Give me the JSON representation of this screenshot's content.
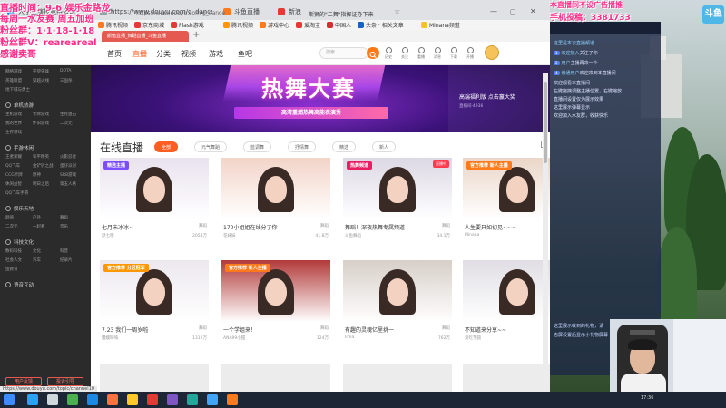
{
  "browser": {
    "tabs": [
      {
        "label": "大学生演技竞赛公司",
        "color": "#1e88e5"
      },
      {
        "label": "https://www.douyu.com/g_dance",
        "color": "#9aa0a6"
      },
      {
        "label": "斗鱼直播",
        "color": "#ff7a1a"
      },
      {
        "label": "新浪",
        "color": "#e53935"
      }
    ],
    "address_url": "https://www.douyu.com/g_dance",
    "address_news": "斯狮的\"二舞\"指挥证办下来",
    "bookmarks": [
      {
        "label": "腾讯视频",
        "color": "#ff7a1a"
      },
      {
        "label": "京东商城",
        "color": "#e53935"
      },
      {
        "label": "Flash游戏",
        "color": "#e53935"
      },
      {
        "label": "腾讯视频",
        "color": "#ff9800"
      },
      {
        "label": "游戏中心",
        "color": "#ff7a1a"
      },
      {
        "label": "爱淘宝",
        "color": "#e53935"
      },
      {
        "label": "中国人",
        "color": "#d32f2f"
      },
      {
        "label": "头条 · 相关文章",
        "color": "#1565c0"
      },
      {
        "label": "Minana频道",
        "color": "#fbc02d"
      }
    ],
    "active_tab": "颜值直播_舞蹈直播_斗鱼直播",
    "status_url": "https://www.douyu.com/topic/channel10"
  },
  "site": {
    "nav": [
      "首页",
      "直播",
      "分类",
      "视频",
      "游戏",
      "鱼吧"
    ],
    "nav_active_index": 1,
    "search_placeholder": "搜索",
    "nav_icons": [
      "历史",
      "关注",
      "看播",
      "消息",
      "下载",
      "开播"
    ],
    "sidebar": {
      "sections": [
        {
          "head": "",
          "rows": [
            [
              "网络游戏",
              "守望先锋",
              "DOTA"
            ],
            [
              "英雄联盟",
              "穿越火线",
              "三国杀"
            ],
            [
              "地下城与勇士",
              "",
              ""
            ]
          ]
        },
        {
          "head": "单机热游",
          "rows": [
            [
              "主机游戏",
              "卡牌游戏",
              "生死狙击"
            ],
            [
              "我的世界",
              "怀旧游戏",
              "二次元"
            ],
            [
              "生存游戏",
              "",
              ""
            ]
          ]
        },
        {
          "head": "手游休闲",
          "rows": [
            [
              "王者荣耀",
              "和平精英",
              "火影忍者"
            ],
            [
              "QQ飞车",
              "金铲铲之战",
              "蛋仔派对"
            ],
            [
              "CCG卡牌",
              "原神",
              "SRB游戏"
            ],
            [
              "休闲益智",
              "明日之后",
              "第五人格"
            ],
            [
              "QQ飞车手游",
              "",
              ""
            ]
          ]
        },
        {
          "head": "娱乐天地",
          "rows": [
            [
              "颜值",
              "户外",
              "舞蹈"
            ],
            [
              "二次元",
              "一起看",
              "音乐"
            ]
          ]
        },
        {
          "head": "科技文化",
          "rows": [
            [
              "数码科技",
              "文化",
              "科普"
            ],
            [
              "社会人文",
              "汽车",
              "纪录片"
            ],
            [
              "鱼教育",
              "",
              ""
            ]
          ]
        },
        {
          "head": "语音互动",
          "rows": []
        }
      ],
      "buttons": [
        "用户反馈",
        "投诉引导"
      ]
    },
    "banner": {
      "title": "热舞大赛",
      "ribbon": "高清重燃热舞高能表演秀",
      "sub": "DOUYU · DANCE",
      "right_title": "高端福利版 点击赢大奖",
      "right_sub": "直播间·4936"
    },
    "live_title": "在线直播",
    "filters": [
      "全部",
      "元气舞蹈",
      "蓝调舞",
      "抒情舞",
      "精选",
      "新人"
    ],
    "filter_active_index": 0,
    "cards": [
      {
        "tag": "精选主播",
        "tag_color": "#7c4dff",
        "title": "七月未冰冰~",
        "cat": "舞蹈",
        "anchor": "默七哦",
        "heat": "2054万",
        "promo": "",
        "palette": "#e9e2ef"
      },
      {
        "tag": "",
        "tag_color": "",
        "title": "170小姐姐在线分了你",
        "cat": "舞蹈",
        "anchor": "花妹妹",
        "heat": "41.8万",
        "promo": "",
        "palette": "#f2d4c8"
      },
      {
        "tag": "热舞频道",
        "tag_color": "#e91e63",
        "live": "直播中",
        "title": "舞蹈！深夜热舞专属频道",
        "cat": "舞蹈",
        "anchor": "斗鱼舞蹈",
        "heat": "34.1万",
        "promo": "",
        "palette": "#dcd8e4"
      },
      {
        "tag": "官方推荐 新人主播",
        "tag_color": "#ff7a1a",
        "title": "人生要只如初见~~~",
        "cat": "舞蹈",
        "anchor": "Minana",
        "heat": "",
        "promo": "",
        "palette": "#ead6c8"
      },
      {
        "tag": "官方推荐 分区冠军",
        "tag_color": "#ff9800",
        "title": "7.23 我们一周岁啦",
        "cat": "舞蹈",
        "anchor": "嫚嫚呀嗨",
        "heat": "1312万",
        "promo": "",
        "palette": "#ece8ee"
      },
      {
        "tag": "官方推荐 新人主播",
        "tag_color": "#ff7a1a",
        "title": "一个学姐来！",
        "cat": "舞蹈",
        "anchor": "ANA99小甜",
        "heat": "124万",
        "promo": "",
        "palette": "#b33a3a"
      },
      {
        "tag": "",
        "tag_color": "",
        "title": "有趣的灵魂亿里挑一",
        "cat": "舞蹈",
        "anchor": "Irma",
        "heat": "762万",
        "promo": "",
        "palette": "#d7cfc8"
      },
      {
        "tag": "",
        "tag_color": "",
        "title": "不知道来分享~~",
        "cat": "舞蹈",
        "anchor": "爱吃芋圆",
        "heat": "",
        "promo": "",
        "palette": "#e0dee4"
      }
    ]
  },
  "overlay": {
    "broadcast_time": "直播时间：9-6 娱乐金路龙",
    "weekly": "每周一水友赛 周五加班",
    "fan_line": "粉丝群：1·1·18-1·18",
    "fan_group": "粉丝群V：reareareal",
    "thanks": "感谢卖哥",
    "right_top": "本直播间不设广告播推",
    "right_num": "手机投稿：3381733",
    "chat": [
      {
        "n": "这里是本次直播频道",
        "t": ""
      },
      {
        "n": "欢迎加入",
        "t": "关注了你",
        "lv": "1"
      },
      {
        "n": "用户",
        "t": "主播再来一个",
        "lv": "2"
      },
      {
        "n": "普通用户",
        "t": "欢迎来到本直播间",
        "lv": "4"
      },
      {
        "n": "",
        "t": "欢迎观看本直播间"
      },
      {
        "n": "",
        "t": "左键拖拽调整主播位置，右键缩放"
      },
      {
        "n": "",
        "t": "直播间设置仅为展示效果"
      },
      {
        "n": "",
        "t": "这里展示弹幕显示"
      },
      {
        "n": "",
        "t": "欢迎加入水友群，收获快乐"
      }
    ],
    "chat_bottom": [
      "这里展示收到的礼物，请",
      "志屏设置后显示小礼物屏幕"
    ],
    "logo": "斗鱼"
  },
  "taskbar": {
    "clock": "17:36"
  }
}
